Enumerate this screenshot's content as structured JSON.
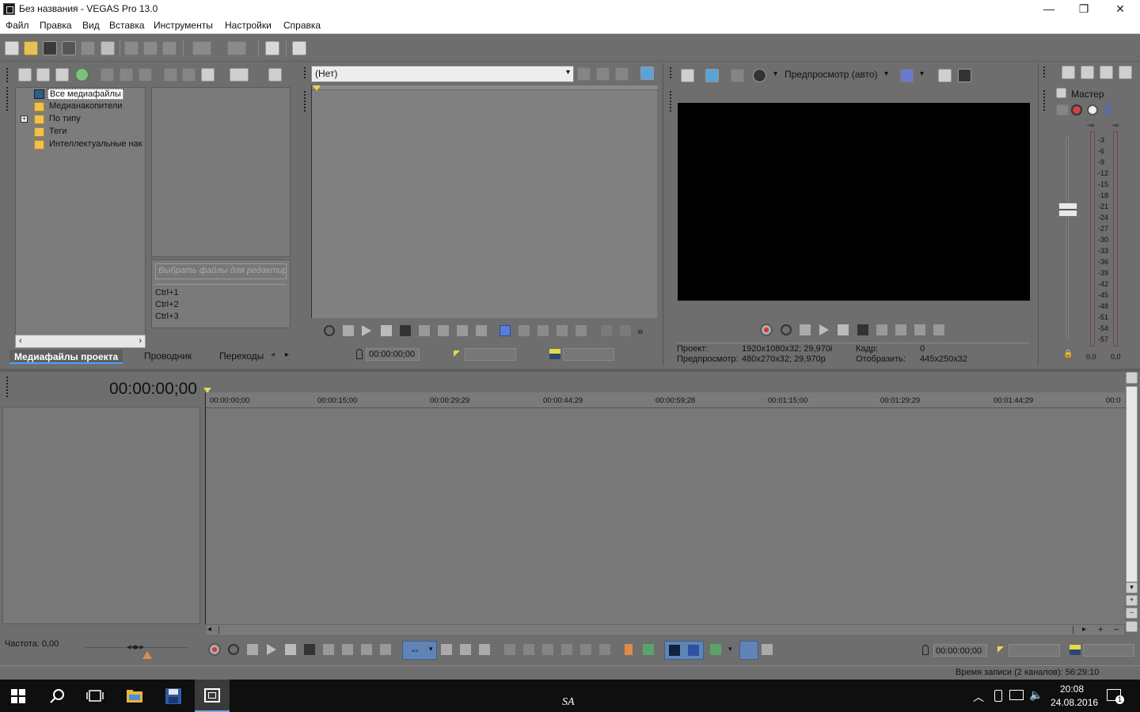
{
  "window": {
    "title": "Без названия - VEGAS Pro 13.0",
    "controls": {
      "minimize": "—",
      "maximize": "❐",
      "close": "✕"
    }
  },
  "menu": [
    "Файл",
    "Правка",
    "Вид",
    "Вставка",
    "Инструменты",
    "Настройки",
    "Справка"
  ],
  "project_media": {
    "tree": [
      {
        "label": "Все медиафайлы",
        "selected": true
      },
      {
        "label": "Медианакопители"
      },
      {
        "label": "По типу",
        "expandable": true
      },
      {
        "label": "Теги"
      },
      {
        "label": "Интеллектуальные нак"
      }
    ],
    "search_placeholder": "Выбрать файлы для редактиро.",
    "shortcuts": [
      "Ctrl+1",
      "Ctrl+2",
      "Ctrl+3"
    ],
    "tabs": [
      "Медиафайлы проекта",
      "Проводник",
      "Переходы"
    ]
  },
  "trimmer": {
    "dropdown": "(Нет)",
    "timecode": "00:00:00;00"
  },
  "preview": {
    "mode": "Предпросмотр (авто)",
    "info": {
      "project_label": "Проект:",
      "project_value": "1920x1080x32; 29,970i",
      "preview_label": "Предпросмотр:",
      "preview_value": "480x270x32; 29,970p",
      "frame_label": "Кадр:",
      "frame_value": "0",
      "display_label": "Отобразить:",
      "display_value": "445x250x32"
    }
  },
  "master": {
    "label": "Мастер",
    "scale": [
      "3",
      "6",
      "9",
      "12",
      "15",
      "18",
      "21",
      "24",
      "27",
      "30",
      "33",
      "36",
      "39",
      "42",
      "45",
      "48",
      "51",
      "54",
      "57"
    ],
    "top_marks": [
      "-∞",
      "-∞"
    ],
    "left_value": "0,0",
    "right_value": "0,0"
  },
  "timeline": {
    "cursor_time": "00:00:00;00",
    "ruler": [
      "00:00:00;00",
      "00:00:15;00",
      "00:00:29;29",
      "00:00:44;29",
      "00:00:59;28",
      "00:01:15;00",
      "00:01:29;29",
      "00:01:44;29",
      "00:0"
    ],
    "rate_label": "Частота: 0,00",
    "bottom_timecode": "00:00:00;00"
  },
  "status": {
    "recording_time": "Время записи (2 каналов): 56:29:10"
  },
  "taskbar": {
    "time": "20:08",
    "date": "24.08.2016",
    "watermark": "SA",
    "notification_count": "1"
  }
}
